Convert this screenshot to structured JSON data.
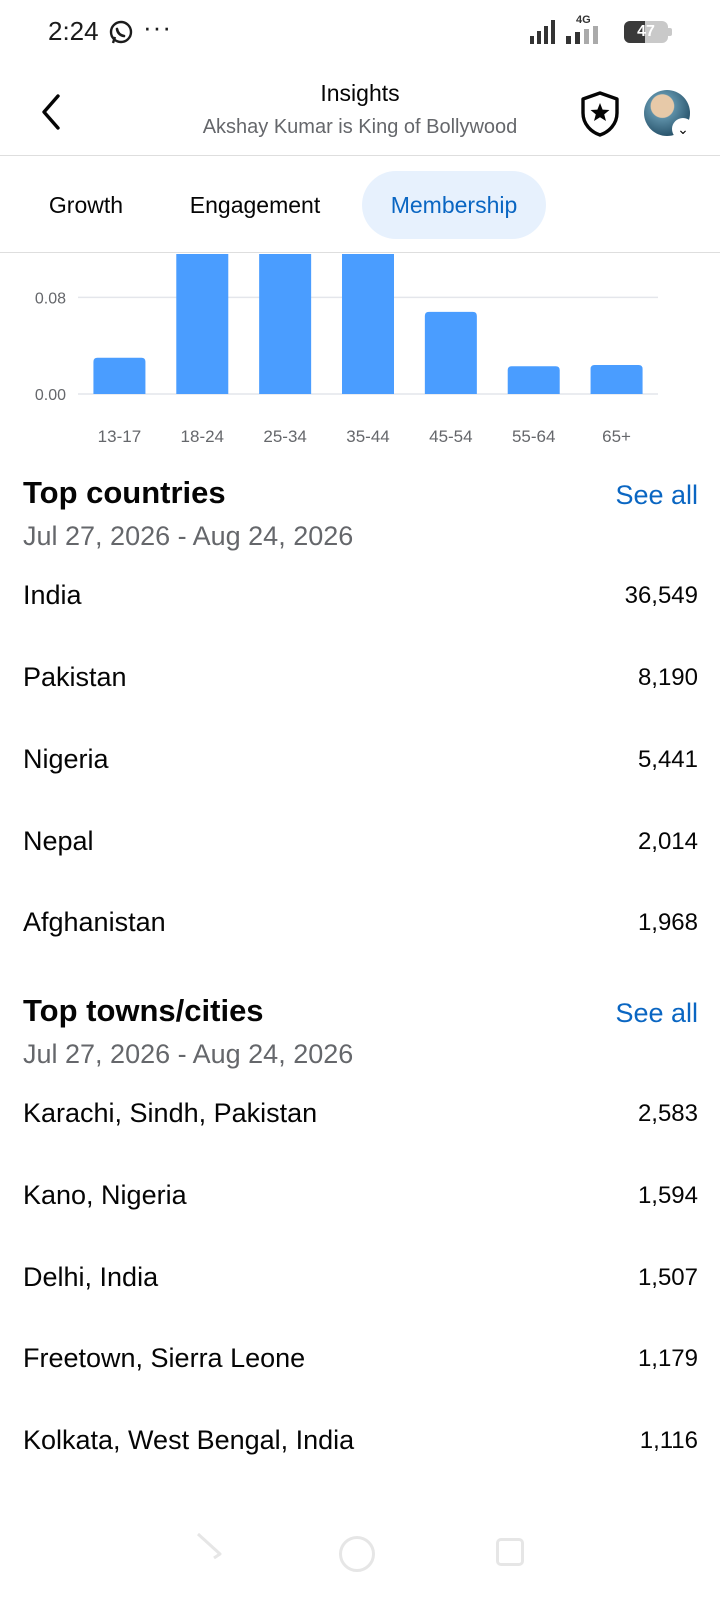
{
  "status_bar": {
    "time": "2:24",
    "more": "···",
    "network": "4G",
    "battery": "47",
    "battery_level": 0.47,
    "icons": [
      "whatsapp-icon",
      "signal-icon",
      "battery-icon"
    ]
  },
  "header": {
    "title": "Insights",
    "subtitle": "Akshay Kumar is King of Bollywood",
    "icons": [
      "back-arrow-icon",
      "shield-star-icon",
      "avatar",
      "chevron-down-icon"
    ]
  },
  "tabs": [
    {
      "label": "Growth",
      "active": false
    },
    {
      "label": "Engagement",
      "active": false
    },
    {
      "label": "Membership",
      "active": true
    }
  ],
  "colors": {
    "accent": "#0a66c2",
    "active_tab_bg": "#e7f1fd",
    "bar": "#4a9dff",
    "secondary_text": "#65676b"
  },
  "chart_data": {
    "type": "bar",
    "categories": [
      "13-17",
      "18-24",
      "25-34",
      "35-44",
      "45-54",
      "55-64",
      "65+"
    ],
    "values": [
      0.03,
      0.17,
      0.17,
      0.17,
      0.068,
      0.023,
      0.024
    ],
    "yticks": [
      "0.00",
      "0.08"
    ],
    "ytick_values": [
      0,
      0.08
    ],
    "ylim_visible": [
      0,
      0.12
    ],
    "grid": true,
    "note_clipped": "bars for 18-24, 25-34 and 35-44 extend beyond the visible top of the chart"
  },
  "top_countries": {
    "title": "Top countries",
    "see_all": "See all",
    "range": "Jul 27, 2026 - Aug 24, 2026",
    "rows": [
      {
        "name": "India",
        "value": "36,549"
      },
      {
        "name": "Pakistan",
        "value": "8,190"
      },
      {
        "name": "Nigeria",
        "value": "5,441"
      },
      {
        "name": "Nepal",
        "value": "2,014"
      },
      {
        "name": "Afghanistan",
        "value": "1,968"
      }
    ]
  },
  "top_cities": {
    "title": "Top towns/cities",
    "see_all": "See all",
    "range": "Jul 27, 2026 - Aug 24, 2026",
    "rows": [
      {
        "name": "Karachi, Sindh, Pakistan",
        "value": "2,583"
      },
      {
        "name": "Kano, Nigeria",
        "value": "1,594"
      },
      {
        "name": "Delhi, India",
        "value": "1,507"
      },
      {
        "name": "Freetown, Sierra Leone",
        "value": "1,179"
      },
      {
        "name": "Kolkata, West Bengal, India",
        "value": "1,116"
      }
    ]
  },
  "nav_bar": {
    "icons": [
      "nav-back-icon",
      "nav-home-icon",
      "nav-recents-icon"
    ]
  }
}
